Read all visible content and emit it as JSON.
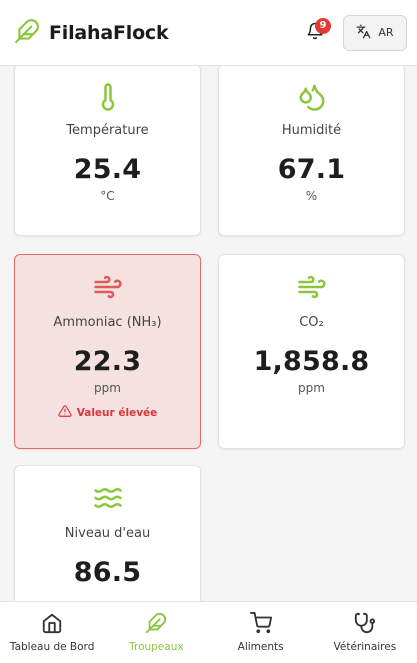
{
  "app": {
    "name": "FilahaFlock"
  },
  "header": {
    "notification_count": "9",
    "language_label": "AR"
  },
  "colors": {
    "accent": "#8cc63f",
    "danger": "#e53935",
    "alert_bg": "#f6e1e1"
  },
  "cards": [
    {
      "id": "temperature",
      "label": "Température",
      "value": "25.4",
      "unit": "°C",
      "icon": "thermometer-icon"
    },
    {
      "id": "humidity",
      "label": "Humidité",
      "value": "67.1",
      "unit": "%",
      "icon": "droplets-icon"
    },
    {
      "id": "ammonia",
      "label": "Ammoniac (NH₃)",
      "value": "22.3",
      "unit": "ppm",
      "icon": "wind-icon",
      "warning": "Valeur élevée"
    },
    {
      "id": "co2",
      "label": "CO₂",
      "value": "1,858.8",
      "unit": "ppm",
      "icon": "wind-icon"
    },
    {
      "id": "water",
      "label": "Niveau d'eau",
      "value": "86.5",
      "icon": "waves-icon"
    }
  ],
  "nav": [
    {
      "label": "Tableau de Bord",
      "icon": "home-icon"
    },
    {
      "label": "Troupeaux",
      "icon": "feather-icon",
      "active": true
    },
    {
      "label": "Aliments",
      "icon": "cart-icon"
    },
    {
      "label": "Vétérinaires",
      "icon": "stethoscope-icon"
    }
  ]
}
